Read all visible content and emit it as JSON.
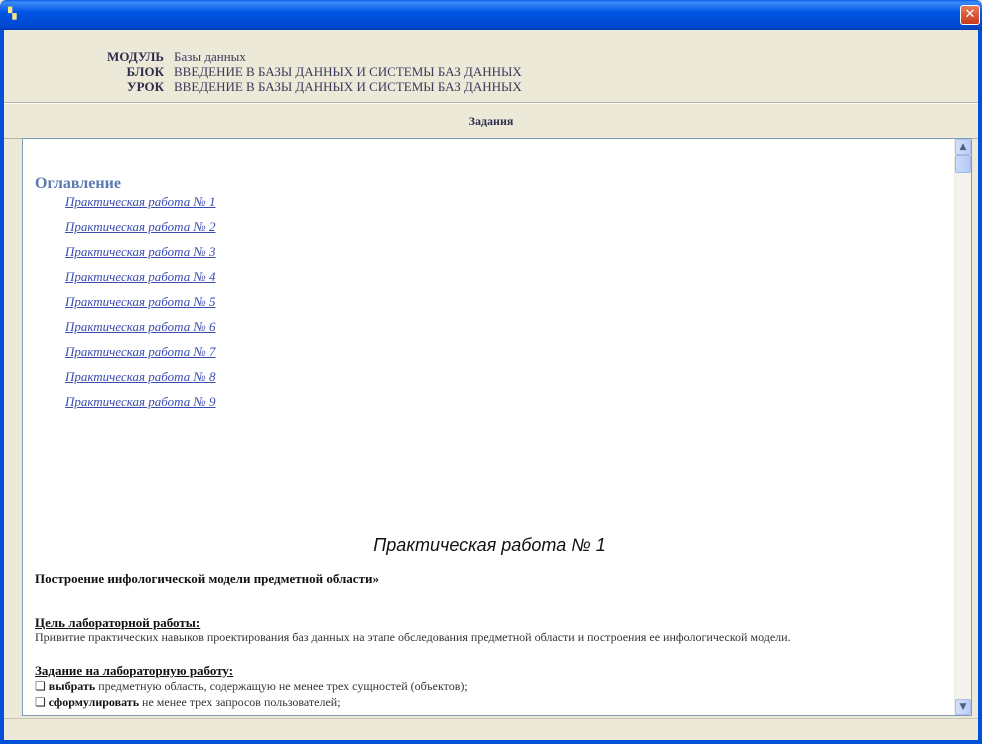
{
  "window": {
    "app_icon": "app-icon",
    "close_glyph": "✕"
  },
  "meta": {
    "rows": [
      {
        "key": "МОДУЛЬ",
        "value": "Базы данных"
      },
      {
        "key": "БЛОК",
        "value": "ВВЕДЕНИЕ В БАЗЫ ДАННЫХ И СИСТЕМЫ  БАЗ ДАННЫХ"
      },
      {
        "key": "УРОК",
        "value": "ВВЕДЕНИЕ В БАЗЫ ДАННЫХ И СИСТЕМЫ  БАЗ ДАННЫХ"
      }
    ]
  },
  "tasks_header": "Задания",
  "toc": {
    "heading": "Оглавление",
    "items": [
      "Практическая работа № 1",
      "Практическая работа № 2",
      "Практическая работа № 3",
      "Практическая работа № 4",
      "Практическая работа № 5",
      "Практическая работа № 6",
      "Практическая работа № 7",
      "Практическая работа № 8",
      "Практическая работа № 9"
    ]
  },
  "work": {
    "title": "Практическая работа № 1",
    "subheading": "Построение инфологической модели предметной области»",
    "goal_label": "Цель лабораторной работы:",
    "goal_text": "Привитие практических навыков проектирования баз данных на этапе обследования предметной области и построения ее инфологической модели.",
    "task_label": "Задание на лабораторную работу:",
    "bullets": [
      {
        "marker": "❏",
        "verb": "выбрать",
        "rest": " предметную область, содержащую не менее трех сущностей (объектов);"
      },
      {
        "marker": "❏",
        "verb": "сформулировать",
        "rest": " не менее трех запросов пользователей;"
      }
    ]
  },
  "colors": {
    "titlebar": "#0055e5",
    "panel": "#ece9d8",
    "link": "#3a4bb0",
    "toc_heading": "#5a7ab0"
  },
  "icons": [
    "app-icon",
    "close-icon",
    "scroll-up-icon",
    "scroll-down-icon"
  ]
}
